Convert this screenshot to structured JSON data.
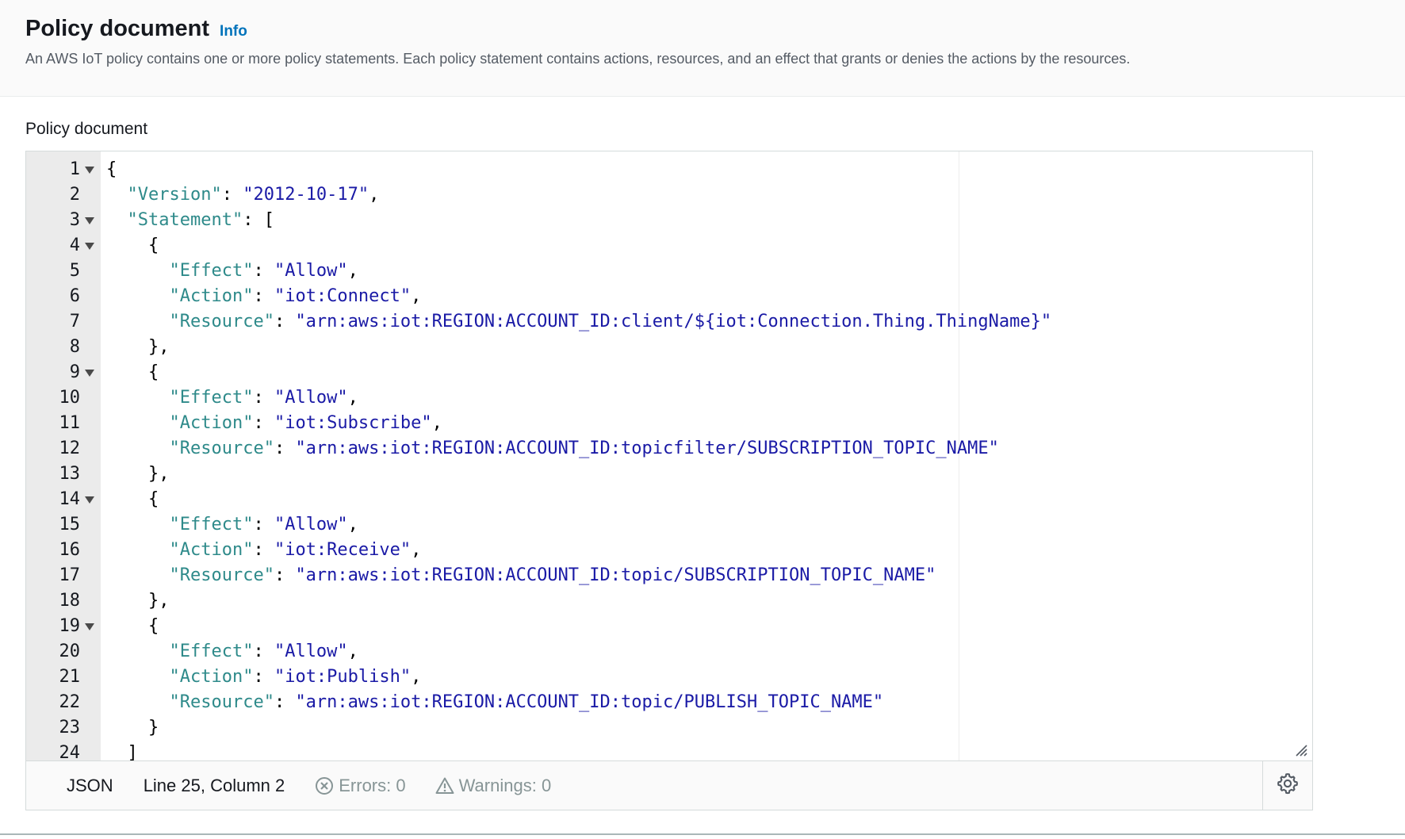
{
  "header": {
    "title": "Policy document",
    "info_link": "Info",
    "description": "An AWS IoT policy contains one or more policy statements. Each policy statement contains actions, resources, and an effect that grants or denies the actions by the resources."
  },
  "field_label": "Policy document",
  "editor": {
    "lines": [
      {
        "num": "1",
        "foldable": true,
        "tokens": [
          {
            "t": "punc",
            "v": "{"
          }
        ]
      },
      {
        "num": "2",
        "foldable": false,
        "tokens": [
          {
            "t": "punc",
            "v": "  "
          },
          {
            "t": "key",
            "v": "\"Version\""
          },
          {
            "t": "punc",
            "v": ": "
          },
          {
            "t": "str",
            "v": "\"2012-10-17\""
          },
          {
            "t": "punc",
            "v": ","
          }
        ]
      },
      {
        "num": "3",
        "foldable": true,
        "tokens": [
          {
            "t": "punc",
            "v": "  "
          },
          {
            "t": "key",
            "v": "\"Statement\""
          },
          {
            "t": "punc",
            "v": ": ["
          }
        ]
      },
      {
        "num": "4",
        "foldable": true,
        "tokens": [
          {
            "t": "punc",
            "v": "    {"
          }
        ]
      },
      {
        "num": "5",
        "foldable": false,
        "tokens": [
          {
            "t": "punc",
            "v": "      "
          },
          {
            "t": "key",
            "v": "\"Effect\""
          },
          {
            "t": "punc",
            "v": ": "
          },
          {
            "t": "str",
            "v": "\"Allow\""
          },
          {
            "t": "punc",
            "v": ","
          }
        ]
      },
      {
        "num": "6",
        "foldable": false,
        "tokens": [
          {
            "t": "punc",
            "v": "      "
          },
          {
            "t": "key",
            "v": "\"Action\""
          },
          {
            "t": "punc",
            "v": ": "
          },
          {
            "t": "str",
            "v": "\"iot:Connect\""
          },
          {
            "t": "punc",
            "v": ","
          }
        ]
      },
      {
        "num": "7",
        "foldable": false,
        "tokens": [
          {
            "t": "punc",
            "v": "      "
          },
          {
            "t": "key",
            "v": "\"Resource\""
          },
          {
            "t": "punc",
            "v": ": "
          },
          {
            "t": "str",
            "v": "\"arn:aws:iot:REGION:ACCOUNT_ID:client/${iot:Connection.Thing.ThingName}\""
          }
        ]
      },
      {
        "num": "8",
        "foldable": false,
        "tokens": [
          {
            "t": "punc",
            "v": "    },"
          }
        ]
      },
      {
        "num": "9",
        "foldable": true,
        "tokens": [
          {
            "t": "punc",
            "v": "    {"
          }
        ]
      },
      {
        "num": "10",
        "foldable": false,
        "tokens": [
          {
            "t": "punc",
            "v": "      "
          },
          {
            "t": "key",
            "v": "\"Effect\""
          },
          {
            "t": "punc",
            "v": ": "
          },
          {
            "t": "str",
            "v": "\"Allow\""
          },
          {
            "t": "punc",
            "v": ","
          }
        ]
      },
      {
        "num": "11",
        "foldable": false,
        "tokens": [
          {
            "t": "punc",
            "v": "      "
          },
          {
            "t": "key",
            "v": "\"Action\""
          },
          {
            "t": "punc",
            "v": ": "
          },
          {
            "t": "str",
            "v": "\"iot:Subscribe\""
          },
          {
            "t": "punc",
            "v": ","
          }
        ]
      },
      {
        "num": "12",
        "foldable": false,
        "tokens": [
          {
            "t": "punc",
            "v": "      "
          },
          {
            "t": "key",
            "v": "\"Resource\""
          },
          {
            "t": "punc",
            "v": ": "
          },
          {
            "t": "str",
            "v": "\"arn:aws:iot:REGION:ACCOUNT_ID:topicfilter/SUBSCRIPTION_TOPIC_NAME\""
          }
        ]
      },
      {
        "num": "13",
        "foldable": false,
        "tokens": [
          {
            "t": "punc",
            "v": "    },"
          }
        ]
      },
      {
        "num": "14",
        "foldable": true,
        "tokens": [
          {
            "t": "punc",
            "v": "    {"
          }
        ]
      },
      {
        "num": "15",
        "foldable": false,
        "tokens": [
          {
            "t": "punc",
            "v": "      "
          },
          {
            "t": "key",
            "v": "\"Effect\""
          },
          {
            "t": "punc",
            "v": ": "
          },
          {
            "t": "str",
            "v": "\"Allow\""
          },
          {
            "t": "punc",
            "v": ","
          }
        ]
      },
      {
        "num": "16",
        "foldable": false,
        "tokens": [
          {
            "t": "punc",
            "v": "      "
          },
          {
            "t": "key",
            "v": "\"Action\""
          },
          {
            "t": "punc",
            "v": ": "
          },
          {
            "t": "str",
            "v": "\"iot:Receive\""
          },
          {
            "t": "punc",
            "v": ","
          }
        ]
      },
      {
        "num": "17",
        "foldable": false,
        "tokens": [
          {
            "t": "punc",
            "v": "      "
          },
          {
            "t": "key",
            "v": "\"Resource\""
          },
          {
            "t": "punc",
            "v": ": "
          },
          {
            "t": "str",
            "v": "\"arn:aws:iot:REGION:ACCOUNT_ID:topic/SUBSCRIPTION_TOPIC_NAME\""
          }
        ]
      },
      {
        "num": "18",
        "foldable": false,
        "tokens": [
          {
            "t": "punc",
            "v": "    },"
          }
        ]
      },
      {
        "num": "19",
        "foldable": true,
        "tokens": [
          {
            "t": "punc",
            "v": "    {"
          }
        ]
      },
      {
        "num": "20",
        "foldable": false,
        "tokens": [
          {
            "t": "punc",
            "v": "      "
          },
          {
            "t": "key",
            "v": "\"Effect\""
          },
          {
            "t": "punc",
            "v": ": "
          },
          {
            "t": "str",
            "v": "\"Allow\""
          },
          {
            "t": "punc",
            "v": ","
          }
        ]
      },
      {
        "num": "21",
        "foldable": false,
        "tokens": [
          {
            "t": "punc",
            "v": "      "
          },
          {
            "t": "key",
            "v": "\"Action\""
          },
          {
            "t": "punc",
            "v": ": "
          },
          {
            "t": "str",
            "v": "\"iot:Publish\""
          },
          {
            "t": "punc",
            "v": ","
          }
        ]
      },
      {
        "num": "22",
        "foldable": false,
        "tokens": [
          {
            "t": "punc",
            "v": "      "
          },
          {
            "t": "key",
            "v": "\"Resource\""
          },
          {
            "t": "punc",
            "v": ": "
          },
          {
            "t": "str",
            "v": "\"arn:aws:iot:REGION:ACCOUNT_ID:topic/PUBLISH_TOPIC_NAME\""
          }
        ]
      },
      {
        "num": "23",
        "foldable": false,
        "tokens": [
          {
            "t": "punc",
            "v": "    }"
          }
        ]
      },
      {
        "num": "24",
        "foldable": false,
        "tokens": [
          {
            "t": "punc",
            "v": "  ]"
          }
        ]
      }
    ]
  },
  "status_bar": {
    "mode": "JSON",
    "cursor_position": "Line 25, Column 2",
    "errors": "Errors: 0",
    "warnings": "Warnings: 0",
    "errors_icon": "error-circle-icon",
    "warnings_icon": "warning-triangle-icon",
    "settings_icon": "gear-icon"
  },
  "colors": {
    "accent_link": "#0073bb",
    "json_key": "#2e8a8a",
    "json_string": "#1a1aa6",
    "gutter_bg": "#ebebeb",
    "status_muted": "#879596"
  }
}
